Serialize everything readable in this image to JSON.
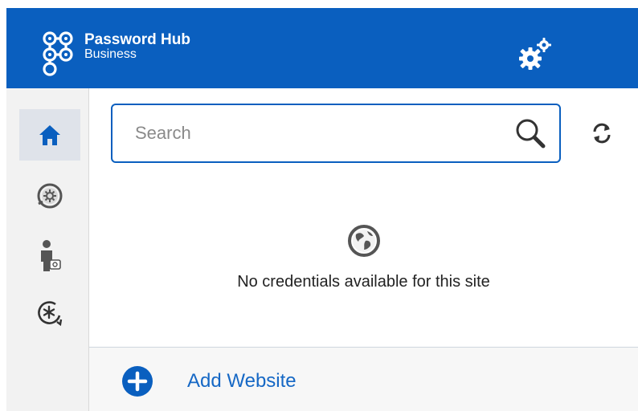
{
  "header": {
    "brand_line1": "Password Hub",
    "brand_line2": "Business",
    "logo_icon": "hub-logo-icon",
    "settings_icon": "gears-icon",
    "background_color": "#0a5fbf"
  },
  "sidebar": {
    "items": [
      {
        "icon": "home-icon",
        "active": true
      },
      {
        "icon": "shield-gear-icon",
        "active": false
      },
      {
        "icon": "user-badge-icon",
        "active": false
      },
      {
        "icon": "recover-asterisk-icon",
        "active": false
      }
    ]
  },
  "search": {
    "placeholder": "Search",
    "value": ""
  },
  "empty_state": {
    "icon": "globe-icon",
    "message": "No credentials available for this site"
  },
  "add_website": {
    "label": "Add Website",
    "icon": "plus-circle-icon",
    "color": "#1668c5"
  }
}
